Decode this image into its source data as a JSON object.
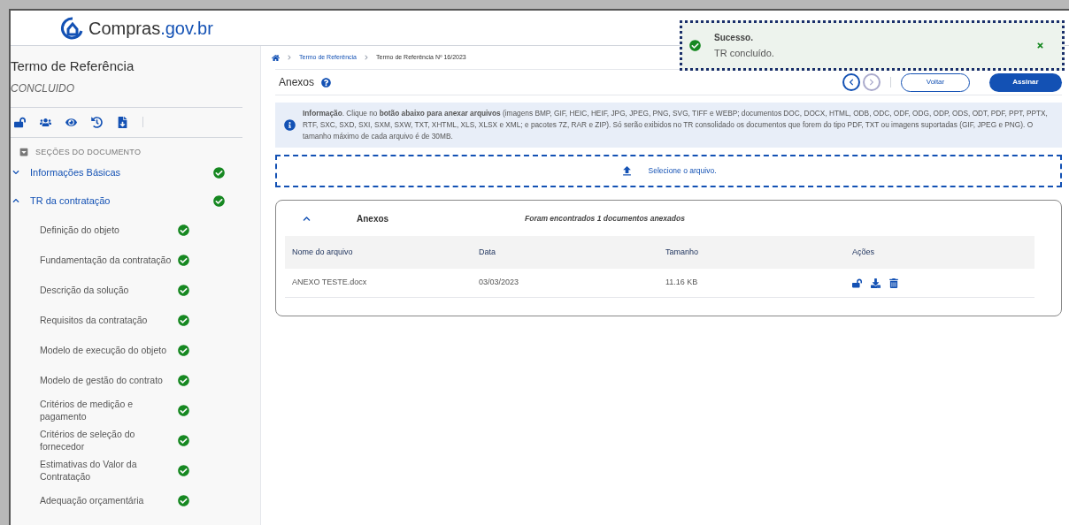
{
  "header": {
    "logo_text": "Compras",
    "logo_domain": ".gov.br"
  },
  "sidebar": {
    "title": "Termo de Referência",
    "status": "CONCLUIDO",
    "section_heading": "SEÇÕES DO DOCUMENTO",
    "sections": [
      {
        "label": "Informações Básicas",
        "expanded": false,
        "completed": true
      },
      {
        "label": "TR da contratação",
        "expanded": true,
        "completed": true,
        "children": [
          {
            "label": "Definição do objeto",
            "completed": true
          },
          {
            "label": "Fundamentação da contratação",
            "completed": true
          },
          {
            "label": "Descrição da solução",
            "completed": true
          },
          {
            "label": "Requisitos da contratação",
            "completed": true
          },
          {
            "label": "Modelo de execução do objeto",
            "completed": true
          },
          {
            "label": "Modelo de gestão do contrato",
            "completed": true
          },
          {
            "label": "Critérios de medição e pagamento",
            "completed": true
          },
          {
            "label": "Critérios de seleção do fornecedor",
            "completed": true
          },
          {
            "label": "Estimativas do Valor da Contratação",
            "completed": true
          },
          {
            "label": "Adequação orçamentária",
            "completed": true
          }
        ]
      }
    ]
  },
  "breadcrumb": [
    {
      "label": "Termo de Referência",
      "link": true
    },
    {
      "label": "Termo de Referência Nº 16/2023",
      "link": false
    }
  ],
  "page_title": "Anexos",
  "buttons": {
    "back": "Voltar",
    "sign": "Assinar"
  },
  "info": "**Informação**. Clique no **botão abaixo para anexar arquivos** (imagens BMP, GIF, HEIC, HEIF, JPG, JPEG, PNG, SVG, TIFF e WEBP; documentos DOC, DOCX, HTML, ODB, ODC, ODF, ODG, ODP, ODS, ODT, PDF, PPT, PPTX, RTF, SXC, SXD, SXI, SXM, SXW, TXT, XHTML, XLS, XLSX e XML; e pacotes 7Z, RAR e ZIP). Só serão exibidos no TR consolidado os documentos que forem do tipo PDF, TXT ou imagens suportadas (GIF, JPEG e PNG). O tamanho máximo de cada arquivo é de 30MB.",
  "upload": {
    "label": "Selecione o arquivo."
  },
  "attachments": {
    "title": "Anexos",
    "expanded": true,
    "summary": "Foram encontrados 1 documentos anexados",
    "columns": [
      "Nome do arquivo",
      "Data",
      "Tamanho",
      "Ações"
    ],
    "rows": [
      {
        "name": "ANEXO TESTE.docx",
        "date": "03/03/2023",
        "size": "11.16 KB"
      }
    ]
  },
  "toast": {
    "title": "Sucesso.",
    "message": "TR concluído."
  }
}
